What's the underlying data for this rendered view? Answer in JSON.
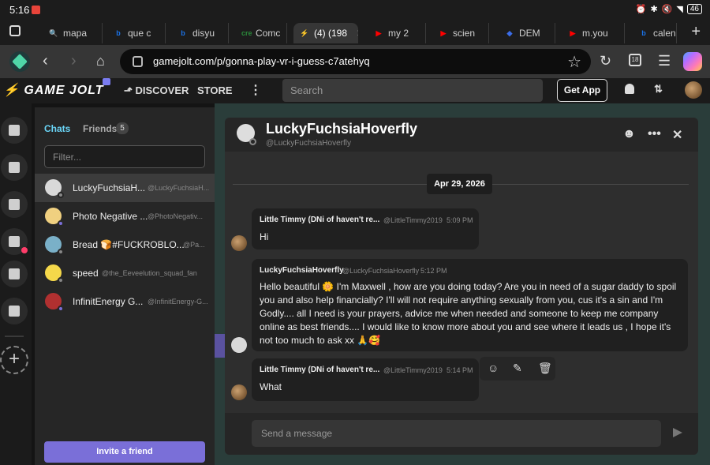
{
  "status": {
    "time": "5:16",
    "battery": "46"
  },
  "browser": {
    "tabs": [
      {
        "label": "mapa",
        "icon_color": "#4a90e2",
        "icon_char": "🔍"
      },
      {
        "label": "que c",
        "icon_color": "#1a73e8",
        "icon_char": "b"
      },
      {
        "label": "disyu",
        "icon_color": "#1a73e8",
        "icon_char": "b"
      },
      {
        "label": "Comc",
        "icon_color": "#2a8a3a",
        "icon_char": "cre"
      },
      {
        "label": "(4) (198",
        "icon_color": "#ccff00",
        "icon_char": "⚡"
      },
      {
        "label": "my 2",
        "icon_color": "#ff0000",
        "icon_char": "▶"
      },
      {
        "label": "scien",
        "icon_color": "#ff0000",
        "icon_char": "▶"
      },
      {
        "label": "DEM",
        "icon_color": "#3b6de8",
        "icon_char": "◆"
      },
      {
        "label": "m.you",
        "icon_color": "#ff0000",
        "icon_char": "▶"
      },
      {
        "label": "calen",
        "icon_color": "#1a73e8",
        "icon_char": "b"
      }
    ],
    "url": "gamejolt.com/p/gonna-play-vr-i-guess-c7atehyq",
    "tab_count": "18"
  },
  "gamejolt": {
    "logo": "GAME JOLT",
    "nav": {
      "discover": "DISCOVER",
      "store": "STORE",
      "more": "⋮"
    },
    "search_placeholder": "Search",
    "get_app": "Get App"
  },
  "chatlist": {
    "tab_chats": "Chats",
    "tab_friends": "Friends",
    "friends_count": "5",
    "filter_placeholder": "Filter...",
    "items": [
      {
        "name": "LuckyFuchsiaH...",
        "user": "@LuckyFuchsiaH...",
        "avatar": "#d9d9d9",
        "dot": "#888888"
      },
      {
        "name": "Photo Negative ...",
        "user": "@PhotoNegativ...",
        "avatar": "#f0d080",
        "dot": "#7a6fd8"
      },
      {
        "name": "Bread 🍞#FUCKROBLO...",
        "user": "@Pa...",
        "avatar": "#7ab0c8",
        "dot": "#888888"
      },
      {
        "name": "speed",
        "user": "@the_Eeveelution_squad_fan",
        "avatar": "#f5d84a",
        "dot": "#888888"
      },
      {
        "name": "InfinitEnergy G...",
        "user": "@InfinitEnergy-G...",
        "avatar": "#b03030",
        "dot": "#7a6fd8"
      }
    ],
    "invite": "Invite a friend"
  },
  "chat": {
    "name": "LuckyFuchsiaHoverfly",
    "username": "@LuckyFuchsiaHoverfly",
    "date": "Apr 29, 2026",
    "messages": [
      {
        "author": "Little Timmy (DNi of haven't re...",
        "handle": "@LittleTimmy2019",
        "time": "5:09 PM",
        "body": "Hi"
      },
      {
        "author": "LuckyFuchsiaHoverfly",
        "handle": "@LuckyFuchsiaHoverfly",
        "time": "5:12 PM",
        "body": "Hello beautiful 🌼 I'm Maxwell , how are you doing today? Are you in need of a sugar daddy to spoil you and also help financially? I'll will not require anything sexually from you, cus it's a sin and I'm Godly.... all I need is your prayers, advice me when needed and someone to keep me company online as best friends.... I would like to know more about you and see where it leads us , I hope it's not too much to ask xx 🙏🥰"
      },
      {
        "author": "Little Timmy (DNi of haven't re...",
        "handle": "@LittleTimmy2019",
        "time": "5:14 PM",
        "body": "What"
      }
    ],
    "composer_placeholder": "Send a message"
  }
}
